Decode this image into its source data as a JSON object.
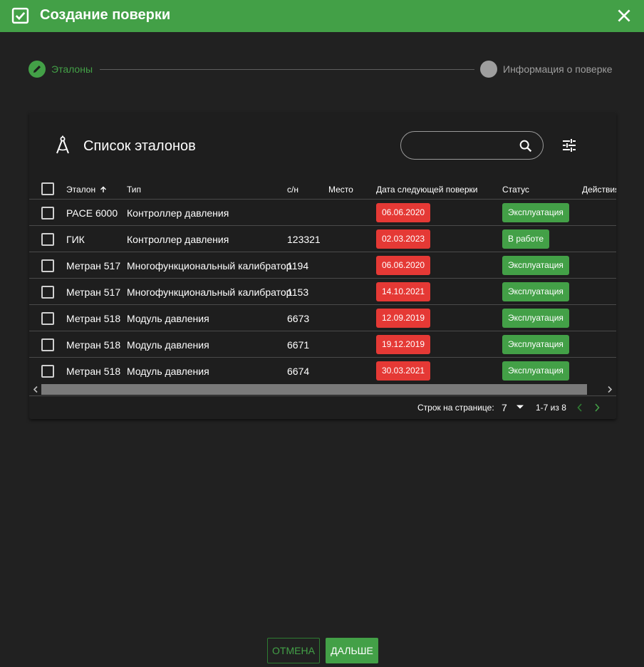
{
  "window": {
    "title": "Создание поверки",
    "accent_color": "#43a047",
    "title_icon": "checkbox-calendar-icon",
    "close_icon": "close-icon"
  },
  "stepper": {
    "steps": [
      {
        "label": "Эталоны",
        "state": "active",
        "icon": "pencil-icon"
      },
      {
        "label": "Информация о поверке",
        "state": "inactive"
      }
    ]
  },
  "card": {
    "title": "Список эталонов",
    "title_icon": "compass-icon",
    "search": {
      "placeholder": "",
      "value": ""
    },
    "filter_icon": "tune-icon"
  },
  "table": {
    "columns": [
      "Эталон",
      "Тип",
      "с/н",
      "Место",
      "Дата следующей поверки",
      "Статус",
      "Действия"
    ],
    "sort": {
      "column": "Эталон",
      "direction": "asc"
    },
    "rows": [
      {
        "name": "PACE 6000",
        "type": "Контроллер давления",
        "serial": "",
        "place": "",
        "date": "06.06.2020",
        "status": "Эксплуатация"
      },
      {
        "name": "ГИК",
        "type": "Контроллер давления",
        "serial": "123321",
        "place": "",
        "date": "02.03.2023",
        "status": "В работе"
      },
      {
        "name": "Метран 517",
        "type": "Многофункциональный калибратор",
        "serial": "1194",
        "place": "",
        "date": "06.06.2020",
        "status": "Эксплуатация"
      },
      {
        "name": "Метран 517",
        "type": "Многофункциональный калибратор",
        "serial": "1153",
        "place": "",
        "date": "14.10.2021",
        "status": "Эксплуатация"
      },
      {
        "name": "Метран 518",
        "type": "Модуль давления",
        "serial": "6673",
        "place": "",
        "date": "12.09.2019",
        "status": "Эксплуатация"
      },
      {
        "name": "Метран 518",
        "type": "Модуль давления",
        "serial": "6671",
        "place": "",
        "date": "19.12.2019",
        "status": "Эксплуатация"
      },
      {
        "name": "Метран 518",
        "type": "Модуль давления",
        "serial": "6674",
        "place": "",
        "date": "30.03.2021",
        "status": "Эксплуатация"
      }
    ],
    "date_badge_color": "#e53935",
    "status_badge_color": "#43a047"
  },
  "pagination": {
    "rows_per_page_label": "Строк на странице:",
    "rows_per_page": "7",
    "range": "1-7 из 8"
  },
  "actions": {
    "cancel": "ОТМЕНА",
    "next": "ДАЛЬШЕ"
  }
}
